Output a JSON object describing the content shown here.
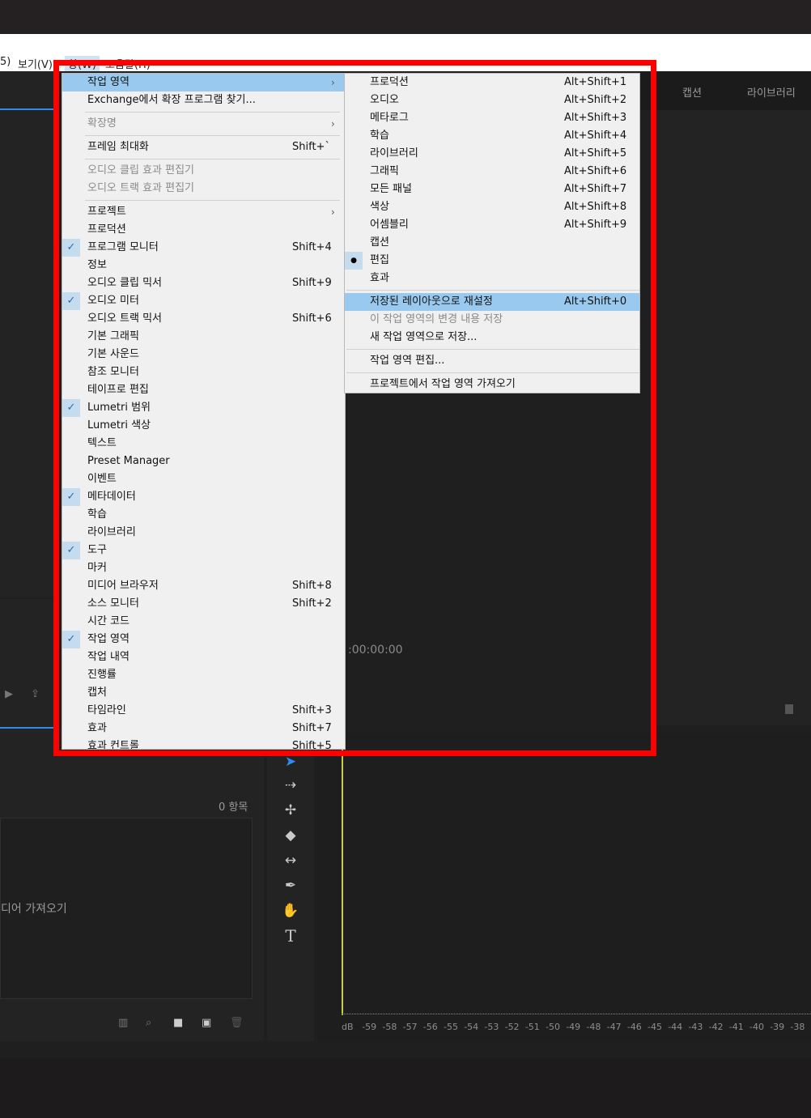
{
  "menubar": {
    "item_left": "5)",
    "view": "보기(V)",
    "window": "창(W)",
    "help": "도움말(H)"
  },
  "tabs_right": {
    "captions": "캡션",
    "libraries": "라이브러리"
  },
  "timecode": ":00:00:00",
  "project_panel": {
    "item_count": "0 항목",
    "import_hint": "디어 가져오기"
  },
  "window_menu": [
    {
      "label": "작업 영역",
      "shortcut": "",
      "submenu": true,
      "highlight": true,
      "checked": false,
      "disabled": false
    },
    {
      "label": "Exchange에서 확장 프로그램 찾기...",
      "shortcut": "",
      "submenu": false,
      "checked": false,
      "disabled": false
    },
    {
      "sep": true
    },
    {
      "label": "확장명",
      "shortcut": "",
      "submenu": true,
      "checked": false,
      "disabled": true
    },
    {
      "sep": true
    },
    {
      "label": "프레임 최대화",
      "shortcut": "Shift+`",
      "submenu": false,
      "checked": false,
      "disabled": false
    },
    {
      "sep": true
    },
    {
      "label": "오디오 클립 효과 편집기",
      "shortcut": "",
      "submenu": false,
      "checked": false,
      "disabled": true
    },
    {
      "label": "오디오 트랙 효과 편집기",
      "shortcut": "",
      "submenu": false,
      "checked": false,
      "disabled": true
    },
    {
      "sep": true
    },
    {
      "label": "프로젝트",
      "shortcut": "",
      "submenu": true,
      "checked": false,
      "disabled": false
    },
    {
      "label": "프로덕션",
      "shortcut": "",
      "submenu": false,
      "checked": false,
      "disabled": false
    },
    {
      "label": "프로그램 모니터",
      "shortcut": "Shift+4",
      "submenu": false,
      "checked": true,
      "disabled": false
    },
    {
      "label": "정보",
      "shortcut": "",
      "submenu": false,
      "checked": false,
      "disabled": false
    },
    {
      "label": "오디오 클립 믹서",
      "shortcut": "Shift+9",
      "submenu": false,
      "checked": false,
      "disabled": false
    },
    {
      "label": "오디오 미터",
      "shortcut": "",
      "submenu": false,
      "checked": true,
      "disabled": false
    },
    {
      "label": "오디오 트랙 믹서",
      "shortcut": "Shift+6",
      "submenu": false,
      "checked": false,
      "disabled": false
    },
    {
      "label": "기본 그래픽",
      "shortcut": "",
      "submenu": false,
      "checked": false,
      "disabled": false
    },
    {
      "label": "기본 사운드",
      "shortcut": "",
      "submenu": false,
      "checked": false,
      "disabled": false
    },
    {
      "label": "참조 모니터",
      "shortcut": "",
      "submenu": false,
      "checked": false,
      "disabled": false
    },
    {
      "label": "테이프로 편집",
      "shortcut": "",
      "submenu": false,
      "checked": false,
      "disabled": false
    },
    {
      "label": "Lumetri 범위",
      "shortcut": "",
      "submenu": false,
      "checked": true,
      "disabled": false
    },
    {
      "label": "Lumetri 색상",
      "shortcut": "",
      "submenu": false,
      "checked": false,
      "disabled": false
    },
    {
      "label": "텍스트",
      "shortcut": "",
      "submenu": false,
      "checked": false,
      "disabled": false
    },
    {
      "label": "Preset Manager",
      "shortcut": "",
      "submenu": false,
      "checked": false,
      "disabled": false
    },
    {
      "label": "이벤트",
      "shortcut": "",
      "submenu": false,
      "checked": false,
      "disabled": false
    },
    {
      "label": "메타데이터",
      "shortcut": "",
      "submenu": false,
      "checked": true,
      "disabled": false
    },
    {
      "label": "학습",
      "shortcut": "",
      "submenu": false,
      "checked": false,
      "disabled": false
    },
    {
      "label": "라이브러리",
      "shortcut": "",
      "submenu": false,
      "checked": false,
      "disabled": false
    },
    {
      "label": "도구",
      "shortcut": "",
      "submenu": false,
      "checked": true,
      "disabled": false
    },
    {
      "label": "마커",
      "shortcut": "",
      "submenu": false,
      "checked": false,
      "disabled": false
    },
    {
      "label": "미디어 브라우저",
      "shortcut": "Shift+8",
      "submenu": false,
      "checked": false,
      "disabled": false
    },
    {
      "label": "소스 모니터",
      "shortcut": "Shift+2",
      "submenu": false,
      "checked": false,
      "disabled": false
    },
    {
      "label": "시간 코드",
      "shortcut": "",
      "submenu": false,
      "checked": false,
      "disabled": false
    },
    {
      "label": "작업 영역",
      "shortcut": "",
      "submenu": false,
      "checked": true,
      "disabled": false
    },
    {
      "label": "작업 내역",
      "shortcut": "",
      "submenu": false,
      "checked": false,
      "disabled": false
    },
    {
      "label": "진행률",
      "shortcut": "",
      "submenu": false,
      "checked": false,
      "disabled": false
    },
    {
      "label": "캡처",
      "shortcut": "",
      "submenu": false,
      "checked": false,
      "disabled": false
    },
    {
      "label": "타임라인",
      "shortcut": "Shift+3",
      "submenu": false,
      "checked": false,
      "disabled": false
    },
    {
      "label": "효과",
      "shortcut": "Shift+7",
      "submenu": false,
      "checked": false,
      "disabled": false
    },
    {
      "label": "효과 컨트롤",
      "shortcut": "Shift+5",
      "submenu": false,
      "checked": false,
      "disabled": false
    }
  ],
  "workspace_submenu": [
    {
      "label": "프로덕션",
      "shortcut": "Alt+Shift+1"
    },
    {
      "label": "오디오",
      "shortcut": "Alt+Shift+2"
    },
    {
      "label": "메타로그",
      "shortcut": "Alt+Shift+3"
    },
    {
      "label": "학습",
      "shortcut": "Alt+Shift+4"
    },
    {
      "label": "라이브러리",
      "shortcut": "Alt+Shift+5"
    },
    {
      "label": "그래픽",
      "shortcut": "Alt+Shift+6"
    },
    {
      "label": "모든 패널",
      "shortcut": "Alt+Shift+7"
    },
    {
      "label": "색상",
      "shortcut": "Alt+Shift+8"
    },
    {
      "label": "어셈블리",
      "shortcut": "Alt+Shift+9"
    },
    {
      "label": "캡션",
      "shortcut": ""
    },
    {
      "label": "편집",
      "shortcut": "",
      "selected": true
    },
    {
      "label": "효과",
      "shortcut": ""
    },
    {
      "sep": true
    },
    {
      "label": "저장된 레이아웃으로 재설정",
      "shortcut": "Alt+Shift+0",
      "highlight": true
    },
    {
      "label": "이 작업 영역의 변경 내용 저장",
      "shortcut": "",
      "disabled": true
    },
    {
      "label": "새 작업 영역으로 저장...",
      "shortcut": ""
    },
    {
      "sep": true
    },
    {
      "label": "작업 영역 편집...",
      "shortcut": ""
    },
    {
      "sep": true
    },
    {
      "label": "프로젝트에서 작업 영역 가져오기",
      "shortcut": ""
    }
  ],
  "audio_ruler": [
    "dB",
    "-59",
    "-58",
    "-57",
    "-56",
    "-55",
    "-54",
    "-53",
    "-52",
    "-51",
    "-50",
    "-49",
    "-48",
    "-47",
    "-46",
    "-45",
    "-44",
    "-43",
    "-42",
    "-41",
    "-40",
    "-39",
    "-38"
  ],
  "colors": {
    "highlight": "#99c9ef",
    "annotation_box": "#ff0000",
    "accent": "#2d8ceb"
  },
  "icons": [
    "selection-tool-icon",
    "track-select-icon",
    "ripple-edit-icon",
    "razor-icon",
    "slip-icon",
    "pen-icon",
    "hand-icon",
    "type-icon"
  ]
}
